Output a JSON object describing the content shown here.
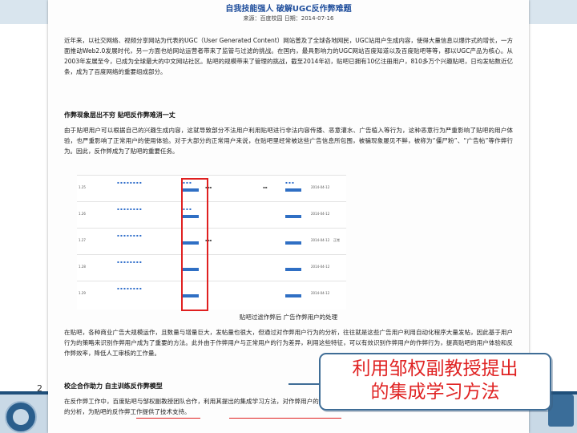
{
  "document": {
    "title": "自我技能强人 破解UGC反作弊难题",
    "meta": "来源：百度校园  日期：2014-07-16",
    "paragraph1": "近年来，以社交网络、视频分享网站为代表的UGC（User Generated Content）网站普及了全球各地网民，UGC站用户生成内容，使得大量信息以爆炸式的增长，一方面推动Web2.0发展时代，另一方面也给网站运营者带来了监管与过滤的挑战。在国内，最具影响力的UGC网站百度知道以及百度贴吧等等，都以UGC产品为核心。从2003年发展至今，已成为全球最大的中文网站社区。贴吧的规模带来了管理的挑战，截至2014年初，贴吧已拥有10亿注册用户，810多万个兴趣贴吧，日均发帖数近亿条，成为了百度网络的重要组成部分。",
    "heading1": "作弊现象层出不穷 贴吧反作弊难消一丈",
    "paragraph2": "由于贴吧用户可以根据自己的兴趣生成内容，这就导致部分不法用户利用贴吧进行非法内容传播、恶意灌水、广告植入等行为，这种恶意行为严重影响了贴吧的用户体验，也严重影响了正常用户的使用体验。对于大部分的正常用户来说，在贴吧里经常被这些广告信息所包围，被骗现象屡见不鲜，被称为“僵尸粉”、“广告帖”等作弊行为。因此，反作弊成为了贴吧的重要任务。",
    "figure_caption": "贴吧过滤作弊后 广告作弊用户的处理",
    "paragraph3": "在贴吧，各种商业广告大规模运作，且数量与增量巨大，发帖量也很大，但通过对作弊用户行为的分析，往往就是这些广告用户利用自动化程序大量发帖，因此基于用户行为的策略来识别作弊用户成为了重要的方法。此外由于作弊用户与正常用户的行为差异，利用这些特征，可以有效识别作弊用户的作弊行为，提高贴吧的用户体验和反作弊效率，降低人工审核的工作量。",
    "heading2": "校企合作助力 自主训练反作弊模型",
    "paragraph4": "在反作弊工作中，百度贴吧与邹权副教授团队合作，利用其提出的集成学习方法，对作弊用户的发帖行为建立了识别模型，从而更有效地对作弊用户进行打击，利用此前的分析，为贴吧的反作弊工作提供了技术支持。"
  },
  "table": {
    "rows": [
      {
        "id": "1.25",
        "user": "加料粉",
        "status": "已处理",
        "date": "2014-04-12",
        "tag": "正常"
      },
      {
        "id": "1.26",
        "user": "",
        "status": "",
        "date": "2014-04-12",
        "tag": ""
      },
      {
        "id": "1.27",
        "user": "",
        "status": "",
        "date": "2014-04-12",
        "tag": "正常"
      },
      {
        "id": "1.28",
        "user": "",
        "status": "",
        "date": "2014-04-12",
        "tag": ""
      },
      {
        "id": "1.29",
        "user": "",
        "status": "",
        "date": "2014-04-12",
        "tag": ""
      }
    ]
  },
  "callout": {
    "line1": "利用邹权副教授提出",
    "line2": "的集成学习方法"
  },
  "slide": {
    "page_number": "2"
  },
  "colors": {
    "highlight_red": "#e02424",
    "callout_border": "#3f6d96",
    "title_blue": "#1f4e9c"
  }
}
